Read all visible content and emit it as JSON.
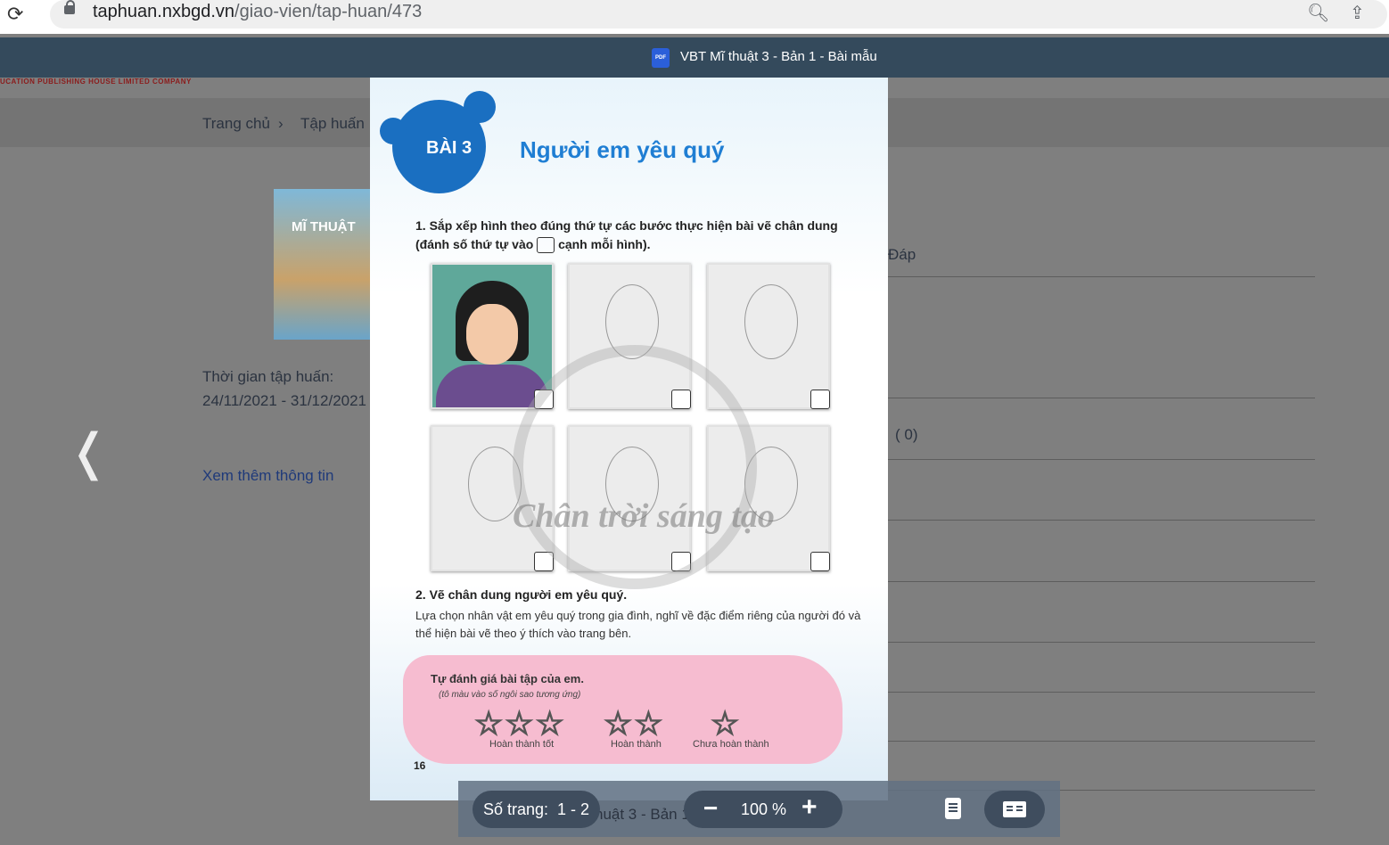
{
  "browser": {
    "url_host": "taphuan.nxbgd.vn",
    "url_path": "/giao-vien/tap-huan/473"
  },
  "viewer": {
    "title": "VBT Mĩ thuật 3 - Bản 1 - Bài mẫu",
    "pdf_icon_text": "PDF"
  },
  "background": {
    "brand_text": "UCATION PUBLISHING HOUSE LIMITED COMPANY",
    "breadcrumb_home": "Trang chủ",
    "breadcrumb_sep": "›",
    "breadcrumb_current": "Tập huấn",
    "book_cover_title": "MĨ THUẬT",
    "training_time_label": "Thời gian tập huấn:",
    "training_time_value": "24/11/2021 - 31/12/2021",
    "more_info_link": "Xem thêm thông tin",
    "right_heading_fragment": "Đáp",
    "right_count_fragment": "( 0)",
    "under_controls_fragment": "huật 3 - Bản 1"
  },
  "page": {
    "lesson_tag": "BÀI 3",
    "lesson_title": "Người em yêu quý",
    "q1_prefix": "1. Sắp xếp hình theo đúng thứ tự các bước thực hiện bài vẽ chân dung (đánh số thứ tự vào",
    "q1_suffix": "cạnh mỗi hình).",
    "watermark": "Chân trời sáng tạo",
    "q2_title": "2. Vẽ chân dung người em yêu quý.",
    "q2_desc": "Lựa chọn nhân vật em yêu quý trong gia đình, nghĩ về đặc điểm riêng của người đó và thể hiện bài vẽ theo ý thích vào trang bên.",
    "self_eval_title": "Tự đánh giá bài tập của em.",
    "self_eval_sub": "(tô màu vào số ngôi sao tương ứng)",
    "rating_groups": [
      {
        "stars": "☆☆☆",
        "label": "Hoàn thành tốt"
      },
      {
        "stars": "☆☆",
        "label": "Hoàn thành"
      },
      {
        "stars": "☆",
        "label": "Chưa hoàn thành"
      }
    ],
    "page_number": "16"
  },
  "controls": {
    "page_count_label": "Số trang:",
    "page_count_value": "1 - 2",
    "zoom_minus": "−",
    "zoom_value": "100 %",
    "zoom_plus": "+"
  },
  "icons": [
    "reload-icon",
    "lock-icon",
    "zoom-icon",
    "share-icon",
    "pdf-icon",
    "prev-arrow-icon",
    "single-page-icon",
    "double-page-icon"
  ]
}
